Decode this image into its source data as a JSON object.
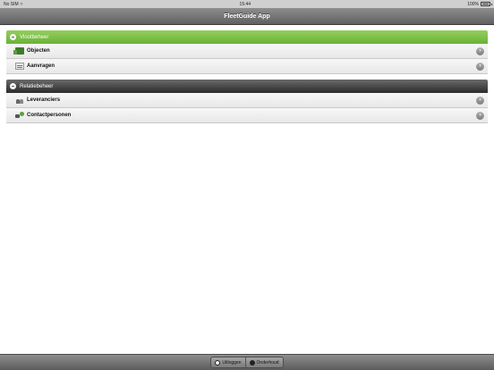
{
  "status_bar": {
    "carrier": "No SIM",
    "wifi_icon": "wifi-icon",
    "time": "15:44",
    "battery": "100%"
  },
  "nav": {
    "title": "FleetGuide App"
  },
  "sections": [
    {
      "header": "Vlootbeheer",
      "header_color": "#7cbd44",
      "items": [
        {
          "label": "Objecten",
          "icon": "truck-icon"
        },
        {
          "label": "Aanvragen",
          "icon": "form-icon"
        }
      ]
    },
    {
      "header": "Relatiebeheer",
      "header_color": "#3a3a3a",
      "items": [
        {
          "label": "Leveranciers",
          "icon": "people-icon"
        },
        {
          "label": "Contactpersonen",
          "icon": "contact-icon"
        }
      ]
    }
  ],
  "toolbar": {
    "uitloggen_label": "Uitloggen",
    "onderhoud_label": "Onderhoud"
  }
}
